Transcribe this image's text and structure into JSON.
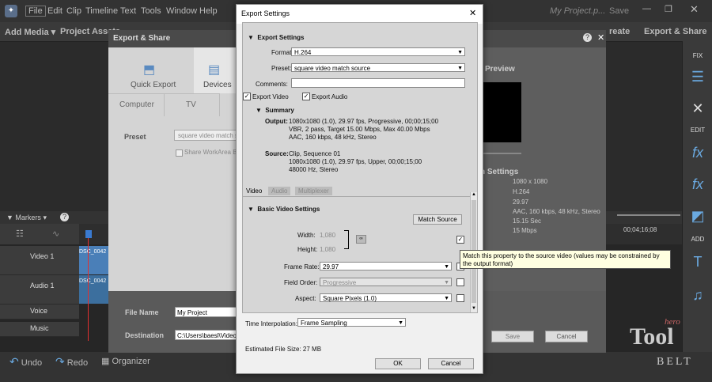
{
  "menubar": {
    "items": [
      "File",
      "Edit",
      "Clip",
      "Timeline",
      "Text",
      "Tools",
      "Window",
      "Help"
    ],
    "project_title": "My Project.p...",
    "save": "Save"
  },
  "toolbar": {
    "add_media": "Add Media",
    "project_assets": "Project Assets",
    "create": "reate",
    "export_share": "Export & Share"
  },
  "right_panel": {
    "fix": "FIX",
    "edit": "EDIT",
    "add": "ADD"
  },
  "export_share": {
    "title": "Export & Share",
    "tabs": [
      "Quick Export",
      "Devices"
    ],
    "subtabs": [
      "Computer",
      "TV"
    ],
    "preset_label": "Preset",
    "preset_value": "square video match so",
    "share_workarea": "Share WorkArea Ba",
    "preview": "Preview",
    "settings_title": "n Settings",
    "settings_values": [
      "1080 x 1080",
      "H.264",
      "29.97",
      "",
      "AAC, 160 kbps, 48 kHz, Stereo",
      "15.15 Sec",
      "15 Mbps"
    ],
    "settings_partial_label": "e",
    "file_name_label": "File Name",
    "file_name_value": "My Project",
    "destination_label": "Destination",
    "destination_value": "C:\\Users\\baesl\\Videos",
    "save_button": "Save",
    "cancel_button": "Cancel"
  },
  "timeline": {
    "markers": "Markers",
    "tracks": [
      "Video 1",
      "Audio 1",
      "Voice",
      "Music"
    ],
    "clip_label": "DSC_0042",
    "timecode": "00;04;16;08"
  },
  "bottom": {
    "undo": "Undo",
    "redo": "Redo",
    "organizer": "Organizer"
  },
  "dialog": {
    "title": "Export Settings",
    "section_title": "Export Settings",
    "format_label": "Format:",
    "format_value": "H.264",
    "preset_label": "Preset:",
    "preset_value": "square video match source",
    "comments_label": "Comments:",
    "export_video": "Export Video",
    "export_audio": "Export Audio",
    "summary_title": "Summary",
    "output_label": "Output:",
    "output_lines": [
      "1080x1080 (1.0), 29.97 fps, Progressive, 00;00;15;00",
      "VBR, 2 pass, Target 15.00 Mbps, Max 40.00 Mbps",
      "AAC, 160 kbps, 48 kHz, Stereo"
    ],
    "source_label": "Source:",
    "source_lines": [
      "Clip, Sequence 01",
      "1080x1080 (1.0), 29.97 fps, Upper, 00;00;15;00",
      "48000 Hz, Stereo"
    ],
    "tabs": [
      "Video",
      "Audio",
      "Multiplexer"
    ],
    "basic_video_title": "Basic Video Settings",
    "match_source_button": "Match Source",
    "width_label": "Width:",
    "width_value": "1,080",
    "height_label": "Height:",
    "height_value": "1,080",
    "frame_rate_label": "Frame Rate:",
    "frame_rate_value": "29.97",
    "field_order_label": "Field Order:",
    "field_order_value": "Progressive",
    "aspect_label": "Aspect:",
    "aspect_value": "Square Pixels (1.0)",
    "time_interp_label": "Time Interpolation:",
    "time_interp_value": "Frame Sampling",
    "est_size": "Estimated File Size:  27 MB",
    "ok": "OK",
    "cancel": "Cancel"
  },
  "tooltip": "Match this property to the source video (values may be constrained by the output format)",
  "watermark": {
    "word1": "Tool",
    "word2": "BELT",
    "hero": "hero"
  }
}
